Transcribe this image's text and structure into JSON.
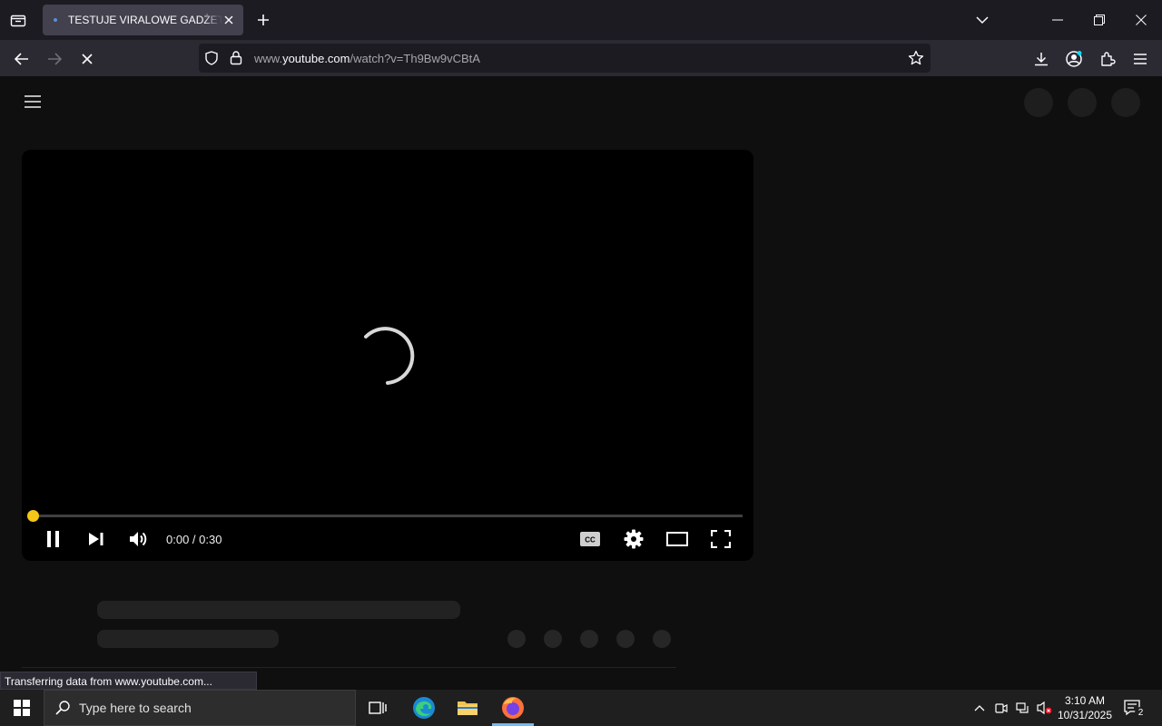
{
  "browser": {
    "tab": {
      "title": "TESTUJE VIRALOWE GADŻETY Z"
    },
    "url": {
      "prefix": "www.",
      "host": "youtube.com",
      "path": "/watch?v=Th9Bw9vCBtA"
    },
    "status_text": "Transferring data from www.youtube.com..."
  },
  "player": {
    "time": "0:00 / 0:30",
    "progress": 0,
    "accent_color": "#f5c518"
  },
  "taskbar": {
    "search_placeholder": "Type here to search",
    "time": "3:10 AM",
    "date": "10/31/2025",
    "notification_count": "2"
  }
}
